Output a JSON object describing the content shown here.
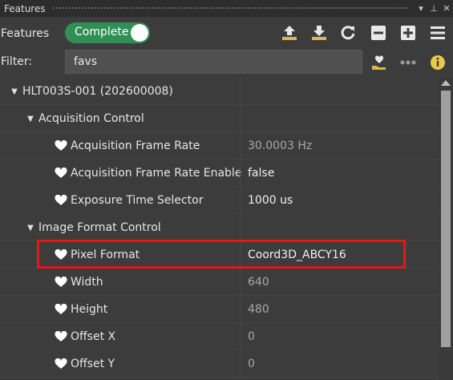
{
  "window": {
    "title": "Features",
    "menu_glyph": "▾",
    "pin_glyph": "⊥",
    "close_glyph": "✕"
  },
  "toolbar": {
    "features_label": "Features",
    "visibility_toggle": "Complete",
    "icons": [
      "upload-icon",
      "download-icon",
      "refresh-icon",
      "collapse-icon",
      "expand-icon",
      "menu-icon"
    ]
  },
  "filter": {
    "label": "Filter:",
    "value": "favs",
    "icons": [
      "favorites-icon",
      "more-icon",
      "info-icon"
    ]
  },
  "tree": {
    "device": "HLT003S-001 (202600008)",
    "categories": [
      {
        "name": "Acquisition Control",
        "features": [
          {
            "name": "Acquisition Frame Rate",
            "value": "30.0003 Hz",
            "editable": false
          },
          {
            "name": "Acquisition Frame Rate Enable",
            "value": "false",
            "editable": true
          },
          {
            "name": "Exposure Time Selector",
            "value": "1000 us",
            "editable": true
          }
        ]
      },
      {
        "name": "Image Format Control",
        "features": [
          {
            "name": "Pixel Format",
            "value": "Coord3D_ABCY16",
            "editable": true
          },
          {
            "name": "Width",
            "value": "640",
            "editable": false
          },
          {
            "name": "Height",
            "value": "480",
            "editable": false
          },
          {
            "name": "Offset X",
            "value": "0",
            "editable": false
          },
          {
            "name": "Offset Y",
            "value": "0",
            "editable": false
          }
        ]
      }
    ]
  },
  "colors": {
    "toggle_on": "#2f8f55",
    "highlight": "#e5161b",
    "background": "#3c3c3c"
  }
}
